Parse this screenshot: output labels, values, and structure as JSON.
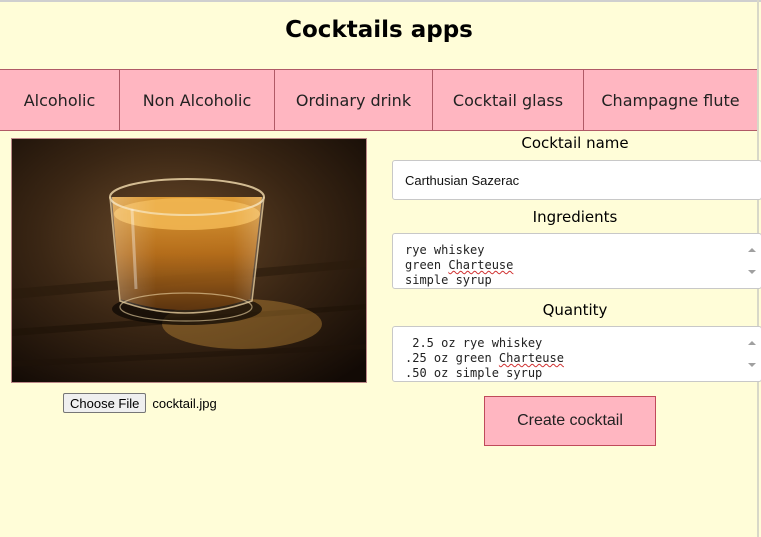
{
  "app": {
    "title": "Cocktails apps"
  },
  "nav": {
    "items": [
      {
        "label": "Alcoholic"
      },
      {
        "label": "Non Alcoholic"
      },
      {
        "label": "Ordinary drink"
      },
      {
        "label": "Cocktail glass"
      },
      {
        "label": "Champagne flute"
      }
    ]
  },
  "image": {
    "description_icon": "cocktail-photo",
    "file_button": "Choose File",
    "file_name": "cocktail.jpg"
  },
  "form": {
    "name_label": "Cocktail name",
    "name_value": "Carthusian Sazerac",
    "ingredients_label": "Ingredients",
    "ingredients": [
      "rye whiskey",
      "green Charteuse",
      "simple syrup"
    ],
    "quantity_label": "Quantity",
    "quantity": [
      " 2.5 oz rye whiskey",
      ".25 oz green Charteuse",
      ".50 oz simple syrup"
    ],
    "submit_label": "Create cocktail"
  },
  "colors": {
    "background": "#fffdd8",
    "accent": "#ffb6c1",
    "border": "#b05a66"
  }
}
